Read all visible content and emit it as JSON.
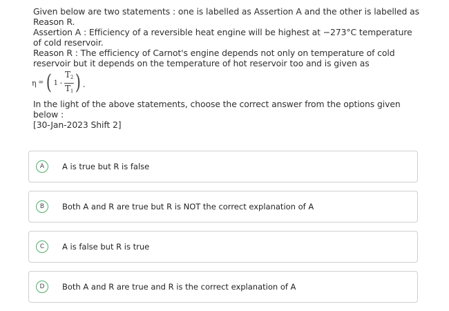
{
  "question": {
    "intro": "Given below are two statements : one is labelled as Assertion A and the other is labelled as Reason R.",
    "assertion": "Assertion A : Efficiency of a reversible heat engine will be highest at −273°C temperature of cold reservoir.",
    "reason": "Reason R : The efficiency of Carnot's engine depends not only on temperature of cold reservoir but it depends on the temperature of hot reservoir too and is given as",
    "formula": {
      "symbol": "η",
      "equals": "=",
      "one": "1",
      "minus": "-",
      "num": "T",
      "num_sub": "2",
      "den": "T",
      "den_sub": "1",
      "end": "."
    },
    "instruction": "In the light of the above statements, choose the correct answer from the options given below :",
    "source": "[30-Jan-2023 Shift 2]"
  },
  "options": [
    {
      "letter": "A",
      "text": "A is true but R is false"
    },
    {
      "letter": "B",
      "text": "Both A and R are true but R is NOT the correct explanation of A"
    },
    {
      "letter": "C",
      "text": "A is false but R is true"
    },
    {
      "letter": "D",
      "text": "Both A and R are true and R is the correct explanation of A"
    }
  ],
  "colors": {
    "badge_border": "#4caf6a",
    "option_border": "#cfcfcf"
  }
}
